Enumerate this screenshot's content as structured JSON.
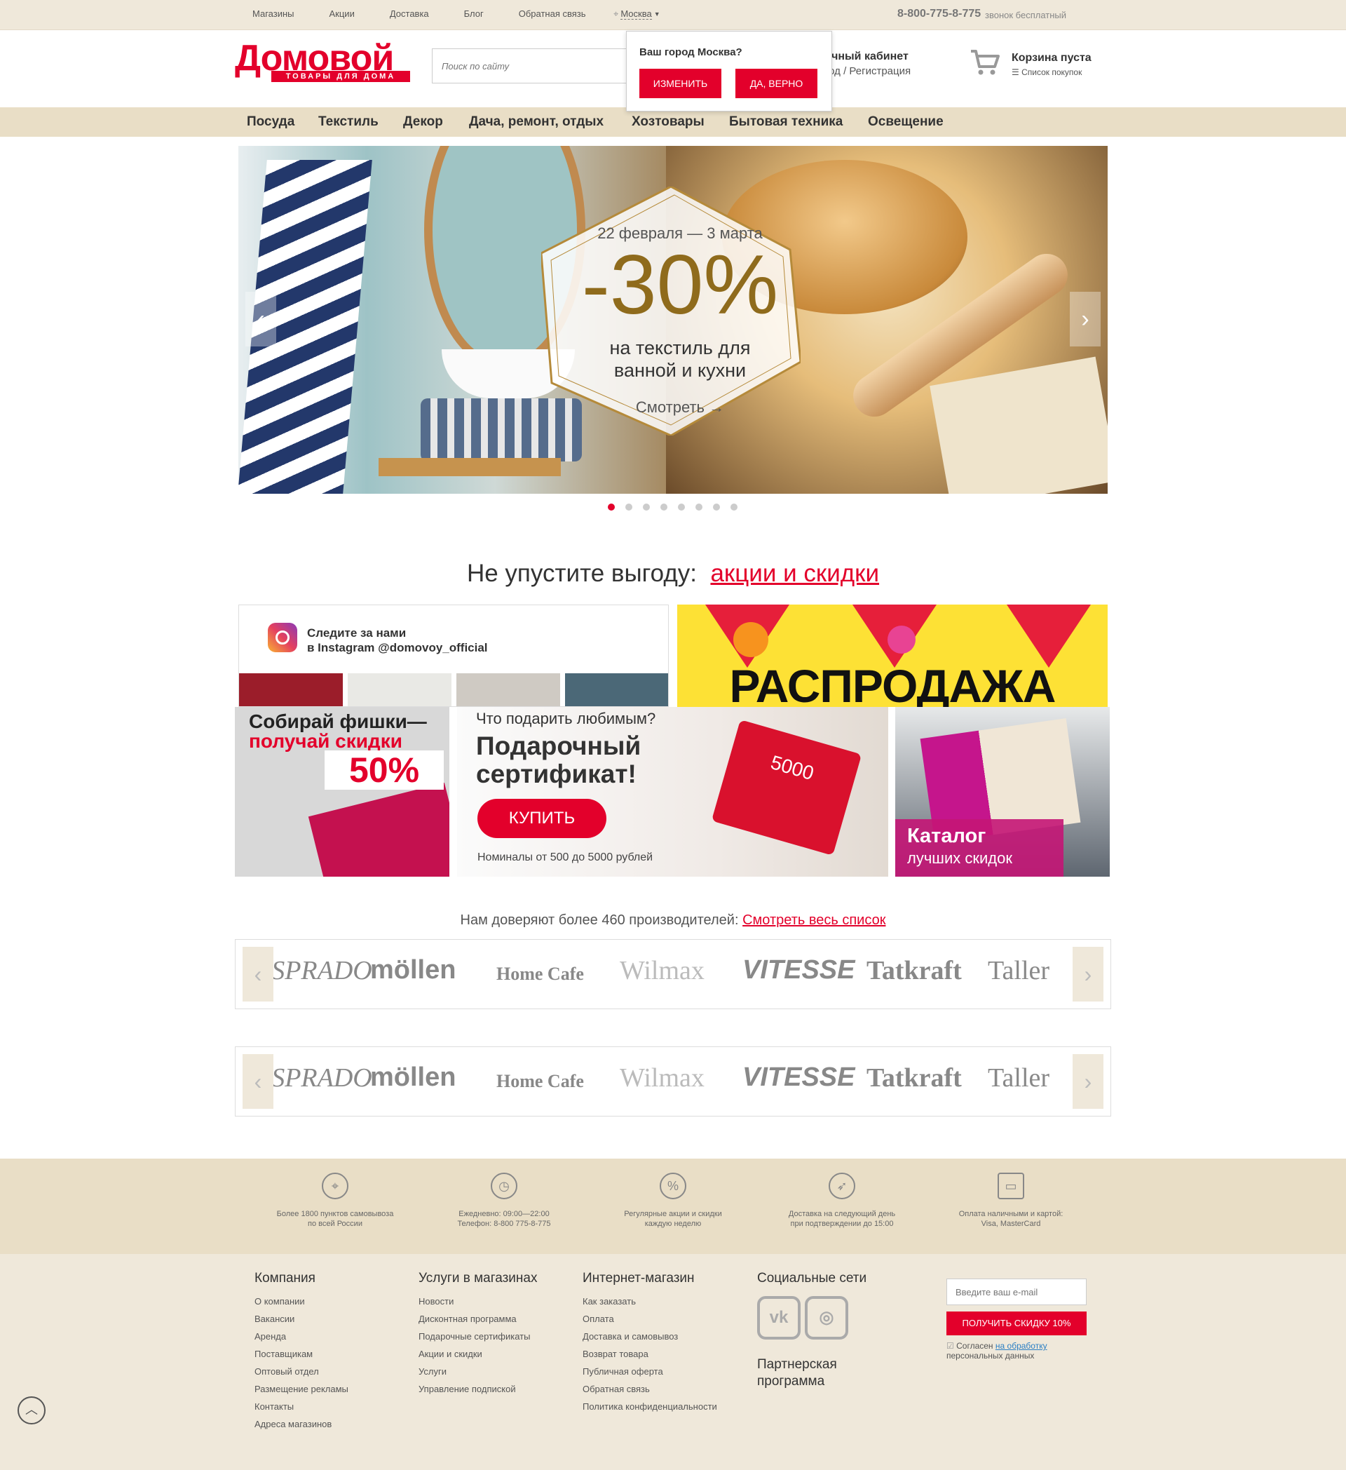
{
  "topbar": {
    "links": [
      "Магазины",
      "Акции",
      "Доставка",
      "Блог",
      "Обратная связь"
    ],
    "city": "Москва",
    "phone": "8-800-775-8-775",
    "phone_note": "звонок бесплатный"
  },
  "header": {
    "logo_word": "Домовой",
    "logo_sub": "ТОВАРЫ ДЛЯ ДОМА",
    "search_placeholder": "Поиск по сайту",
    "account_title": "Личный кабинет",
    "account_sub": "Вход / Регистрация",
    "cart_title": "Корзина пуста",
    "cart_sub": "Список покупок"
  },
  "city_popup": {
    "question": "Ваш город Москва?",
    "change_label": "Изменить",
    "confirm_label": "Да, верно"
  },
  "nav": [
    "Посуда",
    "Текстиль",
    "Декор",
    "Дача, ремонт, отдых",
    "Хозтовары",
    "Бытовая техника",
    "Освещение"
  ],
  "hero": {
    "date": "22 февраля — 3 марта",
    "discount": "-30%",
    "text_line1": "на текстиль для",
    "text_line2": "ванной и кухни",
    "cta": "Смотреть →",
    "slides": 8,
    "active_slide": 1
  },
  "promo": {
    "heading": "Не упустите выгоду:",
    "heading_link": "акции и скидки",
    "instagram_line1": "Следите за нами",
    "instagram_line2": "в Instagram @domovoy_official",
    "sale_title": "РАСПРОДАЖА",
    "chips_line1": "Собирай фишки—",
    "chips_line2": "получай скидки",
    "chips_pct": "50%",
    "gift_question": "Что подарить любимым?",
    "gift_title_line1": "Подарочный",
    "gift_title_line2": "сертификат!",
    "gift_buy": "КУПИТЬ",
    "gift_note": "Номиналы от 500 до 5000 рублей",
    "gift_card_value": "5000",
    "catalog_line1": "Каталог",
    "catalog_line2": "лучших скидок"
  },
  "brands": {
    "heading": "Нам доверяют более 460 производителей:",
    "heading_link": "Смотреть весь список",
    "items": [
      "ESPRADO",
      "möllen",
      "Home Cafe",
      "Wilmax",
      "VITESSE",
      "Tatkraft",
      "Taller"
    ]
  },
  "features": [
    {
      "icon": "location-pin-icon",
      "glyph": "⌖",
      "line1": "Более 1800 пунктов самовывоза",
      "line2": "по всей России"
    },
    {
      "icon": "clock-icon",
      "glyph": "◷",
      "line1": "Ежедневно: 09:00—22:00",
      "line2": "Телефон: 8-800 775-8-775"
    },
    {
      "icon": "percent-icon",
      "glyph": "%",
      "line1": "Регулярные акции и скидки",
      "line2": "каждую неделю"
    },
    {
      "icon": "fast-delivery-icon",
      "glyph": "➶",
      "line1": "Доставка на следующий день",
      "line2": "при подтверждении до 15:00"
    },
    {
      "icon": "payment-card-icon",
      "glyph": "▭",
      "line1": "Оплата наличными и картой:",
      "line2": "Visa, MasterCard"
    }
  ],
  "footer": {
    "company_title": "Компания",
    "company_links": [
      "О компании",
      "Вакансии",
      "Аренда",
      "Поставщикам",
      "Оптовый отдел",
      "Размещение рекламы",
      "Контакты",
      "Адреса магазинов"
    ],
    "services_title": "Услуги в магазинах",
    "services_links": [
      "Новости",
      "Дисконтная программа",
      "Подарочные сертификаты",
      "Акции и скидки",
      "Услуги",
      "Управление подпиской"
    ],
    "shop_title": "Интернет-магазин",
    "shop_links": [
      "Как заказать",
      "Оплата",
      "Доставка и самовывоз",
      "Возврат товара",
      "Публичная оферта",
      "Обратная связь",
      "Политика конфиденциальности"
    ],
    "social_title": "Социальные сети",
    "partner_line1": "Партнерская",
    "partner_line2": "программа",
    "email_placeholder": "Введите ваш e-mail",
    "discount_button": "ПОЛУЧИТЬ СКИДКУ 10%",
    "agree_text": "Согласен",
    "agree_link": "на обработку",
    "agree_text2": "персональных данных"
  },
  "colors": {
    "brand_red": "#e3002b",
    "beige": "#efe8da",
    "nav_beige": "#e9dec6"
  }
}
